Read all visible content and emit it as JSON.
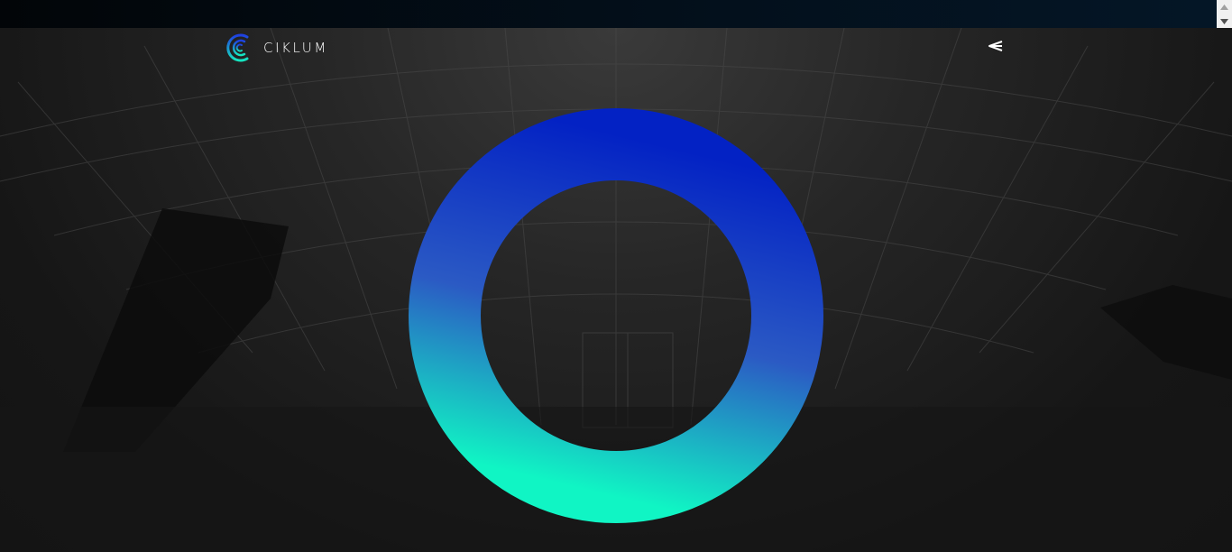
{
  "header": {
    "brand_name": "CIKLUM",
    "logo_icon": "ciklum-logo-icon",
    "share_icon": "share-icon"
  },
  "hero": {
    "ring_colors": {
      "top": "#0322c4",
      "middle": "#2b5ac4",
      "bottom": "#10f5c4"
    }
  },
  "scrollbar": {
    "up_icon": "scroll-up-arrow-icon",
    "down_icon": "scroll-down-arrow-icon"
  }
}
